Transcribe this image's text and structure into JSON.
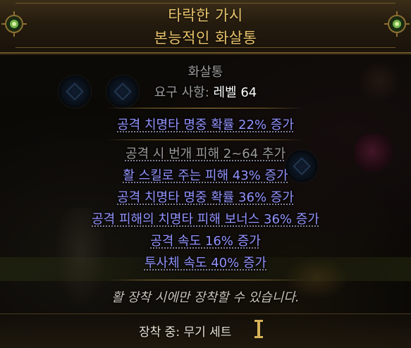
{
  "item": {
    "name": "타락한 가시",
    "base_type": "본능적인 화살통",
    "item_class": "화살통",
    "requirement_label": "요구 사항:",
    "requirement_value": "레벨 64",
    "implicit_mod": "공격 치명타 명중 확률 22% 증가",
    "explicit_mods": [
      "공격 시 번개 피해 2~64 추가",
      "활 스킬로 주는 피해 43% 증가",
      "공격 치명타 명중 확률 36% 증가",
      "공격 피해의 치명타 피해 보너스 36% 증가",
      "공격 속도 16% 증가",
      "투사체 속도 40% 증가"
    ],
    "restriction": "활 장착 시에만 장착할 수 있습니다."
  },
  "equip": {
    "label": "장착 중: 무기 세트",
    "icon": "weapon-set-one-icon"
  },
  "colors": {
    "title": "#e8c36b",
    "magic_mod": "#9393ff",
    "gray_text": "#9b9b9b",
    "white_text": "#ffffff",
    "header_border": "#6b5426"
  }
}
